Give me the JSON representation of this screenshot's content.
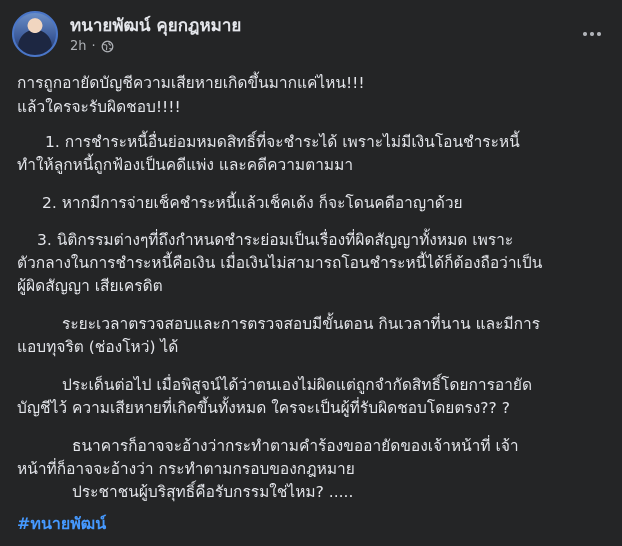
{
  "post": {
    "author": "ทนายพัฒน์ คุยกฎหมาย",
    "time": "2h",
    "dot": "·",
    "lines": [
      "การถูกอายัดบัญชีความเสียหายเกิดขึ้นมากแค่ไหน!!!",
      "แล้วใครจะรับผิดชอบ!!!!",
      "1. การชำระหนี้อื่นย่อมหมดสิทธิ์ที่จะชำระได้ เพราะไม่มีเงินโอนชำระหนี้",
      "ทำให้ลูกหนี้ถูกฟ้องเป็นคดีแพ่ง และคดีความตามมา",
      "2. หากมีการจ่ายเช็คชำระหนี้แล้วเช็คเด้ง ก็จะโดนคดีอาญาด้วย",
      "3. นิติกรรมต่างๆที่ถึงกำหนดชำระย่อมเป็นเรื่องที่ผิดสัญญาทั้งหมด เพราะ",
      "ตัวกลางในการชำระหนี้คือเงิน เมื่อเงินไม่สามารถโอนชำระหนี้ได้ก็ต้องถือว่าเป็น",
      "ผู้ผิดสัญญา เสียเครดิต",
      "ระยะเวลาตรวจสอบและการตรวจสอบมีขั้นตอน กินเวลาที่นาน และมีการ",
      "แอบทุจริต (ช่องโหว่) ได้",
      "ประเด็นต่อไป เมื่อพิสูจน์ได้ว่าตนเองไม่ผิดแต่ถูกจำกัดสิทธิ์โดยการอายัด",
      "บัญชีไว้ ความเสียหายที่เกิดขึ้นทั้งหมด ใครจะเป็นผู้ที่รับผิดชอบโดยตรง?? ?",
      "ธนาคารก็อาจจะอ้างว่ากระทำตามคำร้องขออายัดของเจ้าหน้าที่  เจ้า",
      "หน้าที่ก็อาจจะอ้างว่า กระทำตามกรอบของกฎหมาย",
      "ประชาชนผู้บริสุทธิ์คือรับกรรมใช่ไหม?        ....."
    ],
    "hashtag": "#ทนายพัฒน์"
  },
  "icons": {
    "more": "more-horizontal-icon",
    "audience": "globe-icon"
  },
  "colors": {
    "background": "#242526",
    "text": "#e4e6eb",
    "secondary": "#b0b3b8",
    "link": "#4599ff"
  }
}
